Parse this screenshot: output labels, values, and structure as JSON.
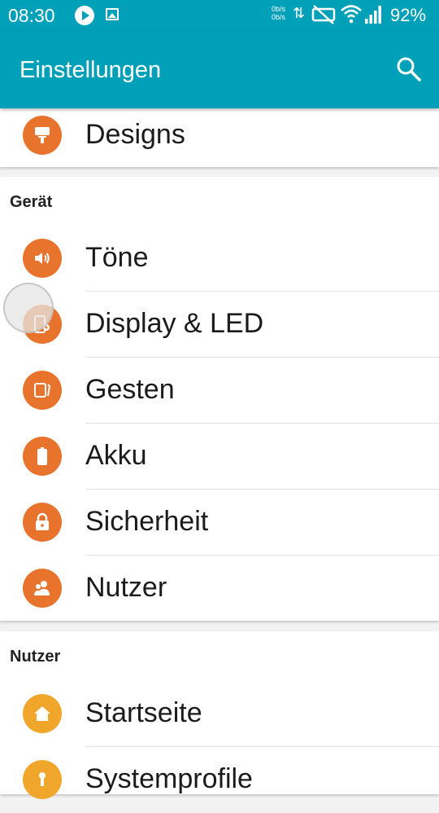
{
  "status_bar": {
    "time": "08:30",
    "net_up": "0b/s",
    "net_down": "0b/s",
    "battery": "92%",
    "icons": [
      "play-icon",
      "image-icon",
      "data-arrows-icon",
      "mute-icon",
      "wifi-icon",
      "signal-icon"
    ]
  },
  "app_bar": {
    "title": "Einstellungen",
    "search_icon": "search-icon"
  },
  "colors": {
    "primary": "#00a1b8",
    "icon_orange": "#e8732d",
    "icon_yellow": "#f0a62b"
  },
  "items": {
    "designs": "Designs",
    "toene": "Töne",
    "display": "Display & LED",
    "gesten": "Gesten",
    "akku": "Akku",
    "sicherheit": "Sicherheit",
    "nutzer": "Nutzer",
    "startseite": "Startseite",
    "systemprofile": "Systemprofile"
  },
  "sections": {
    "device": "Gerät",
    "user": "Nutzer"
  }
}
